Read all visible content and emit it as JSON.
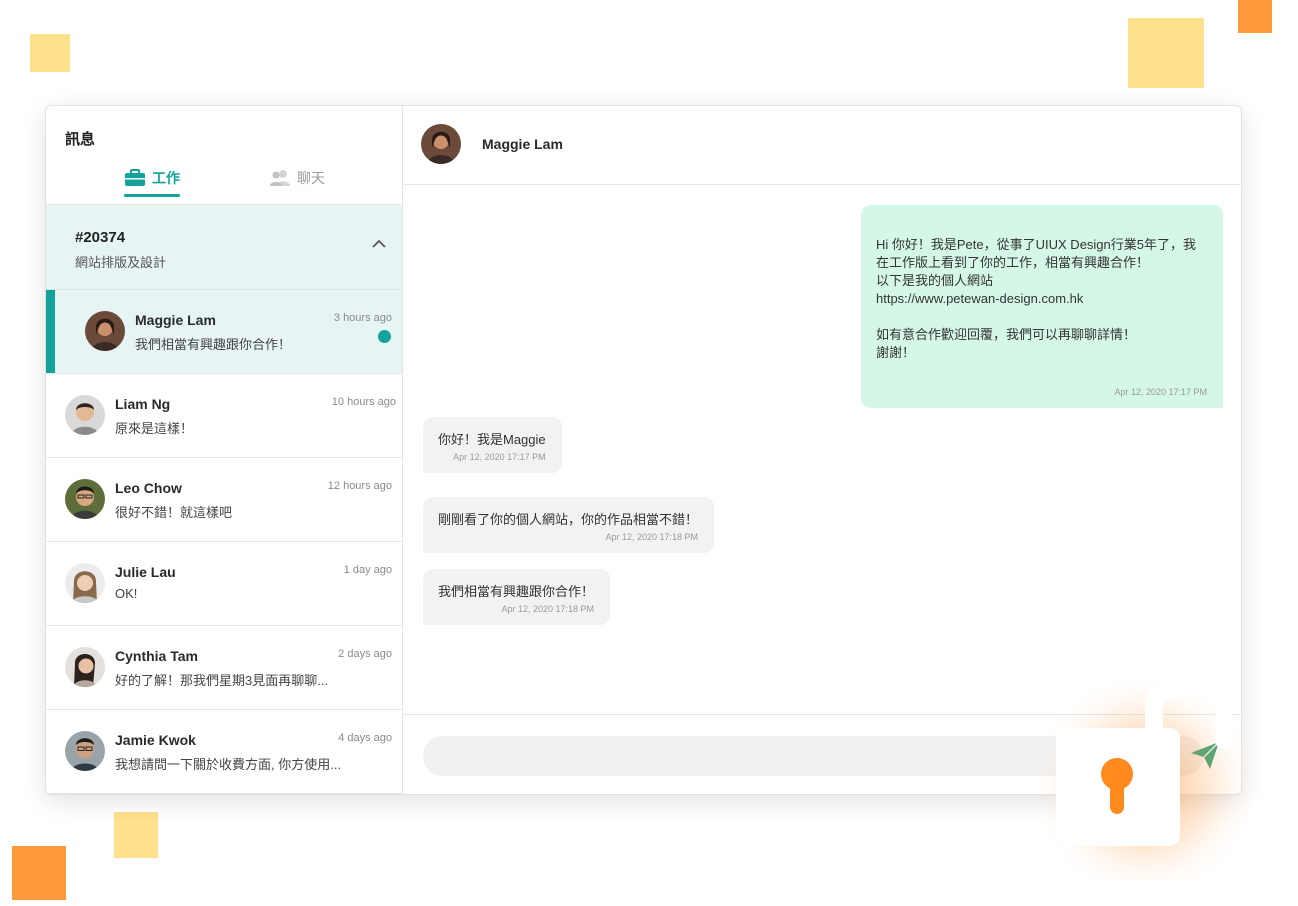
{
  "sidebar": {
    "title": "訊息",
    "tabs": [
      {
        "label": "工作",
        "icon": "briefcase-icon",
        "active": true
      },
      {
        "label": "聊天",
        "icon": "people-icon",
        "active": false
      }
    ],
    "job": {
      "id": "#20374",
      "name": "網站排版及設計"
    },
    "conversations": [
      {
        "name": "Maggie Lam",
        "message": "我們相當有興趣跟你合作！",
        "time": "3 hours ago",
        "unread": true,
        "active": true
      },
      {
        "name": "Liam Ng",
        "message": "原來是這樣！",
        "time": "10 hours ago"
      },
      {
        "name": "Leo Chow",
        "message": "很好不錯！就這樣吧",
        "time": "12 hours ago"
      },
      {
        "name": "Julie Lau",
        "message": "OK!",
        "time": "1 day ago"
      },
      {
        "name": "Cynthia Tam",
        "message": "好的了解！那我們星期3見面再聊聊...",
        "time": "2 days ago"
      },
      {
        "name": "Jamie Kwok",
        "message": "我想請問一下關於收費方面, 你方使用...",
        "time": "4 days ago"
      }
    ]
  },
  "chat": {
    "contact_name": "Maggie Lam",
    "messages": [
      {
        "direction": "out",
        "text": "Hi 你好！我是Pete，從事了UIUX Design行業5年了，我在工作版上看到了你的工作，相當有興趣合作！\n以下是我的個人網站\nhttps://www.petewan-design.com.hk\n\n如有意合作歡迎回覆，我們可以再聊聊詳情！\n謝謝！",
        "time": "Apr 12, 2020 17:17 PM"
      },
      {
        "direction": "in",
        "text": "你好！我是Maggie",
        "time": "Apr 12, 2020 17:17 PM"
      },
      {
        "direction": "in",
        "text": "剛剛看了你的個人網站，你的作品相當不錯！",
        "time": "Apr 12, 2020 17:18 PM"
      },
      {
        "direction": "in",
        "text": "我們相當有興趣跟你合作！",
        "time": "Apr 12, 2020 17:18 PM"
      }
    ],
    "composer": {
      "placeholder": "",
      "send_icon": "send-icon"
    }
  },
  "colors": {
    "accent": "#14a39a",
    "outgoing_bubble": "#d4f7e7",
    "incoming_bubble": "#f2f2f2",
    "deco_yellow": "#ffe08c",
    "deco_orange": "#ff9a3c"
  },
  "overlay": {
    "icon": "unlocked-padlock-icon"
  }
}
